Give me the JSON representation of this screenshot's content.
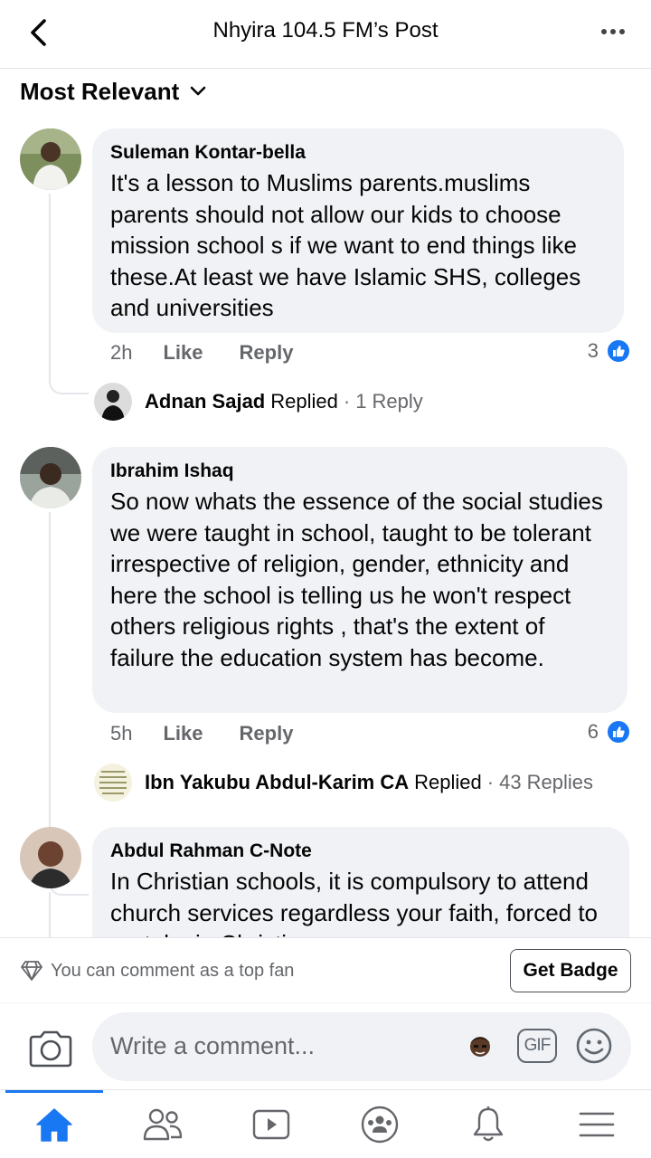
{
  "header": {
    "title": "Nhyira 104.5 FM’s Post"
  },
  "sort": {
    "label": "Most Relevant"
  },
  "comments": [
    {
      "author": "Suleman Kontar-bella",
      "text": "It's a lesson to Muslims parents.muslims parents should not allow our kids to choose mission school s if we want to end things like these.At least we have Islamic SHS, colleges and universities",
      "time": "2h",
      "like_label": "Like",
      "reply_label": "Reply",
      "reaction_count": "3",
      "reply_preview": {
        "name": "Adnan Sajad",
        "verb": "Replied",
        "count": "1 Reply"
      }
    },
    {
      "author": "Ibrahim Ishaq",
      "text": "So now whats the essence of the social studies we were taught in school, taught to be tolerant irrespective of religion,  gender, ethnicity and here the school is telling us he won't respect others religious rights , that's the extent of failure the education system has become.",
      "time": "5h",
      "like_label": "Like",
      "reply_label": "Reply",
      "reaction_count": "6",
      "reply_preview": {
        "name": "Ibn Yakubu Abdul-Karim CA",
        "verb": "Replied",
        "count": "43 Replies"
      }
    },
    {
      "author": "Abdul Rahman C-Note",
      "text": "In Christian schools, it is compulsory to attend church services regardless your faith, forced to partake in Christian"
    }
  ],
  "top_fan": {
    "text": "You can comment as a top fan",
    "button": "Get Badge"
  },
  "composer": {
    "placeholder": "Write a comment...",
    "gif_label": "GIF"
  },
  "colors": {
    "accent": "#1877f2",
    "bubble": "#f0f2f5",
    "secondary_text": "#65676b"
  },
  "tabs": [
    "home-icon",
    "friends-icon",
    "watch-icon",
    "groups-icon",
    "notifications-icon",
    "menu-icon"
  ]
}
